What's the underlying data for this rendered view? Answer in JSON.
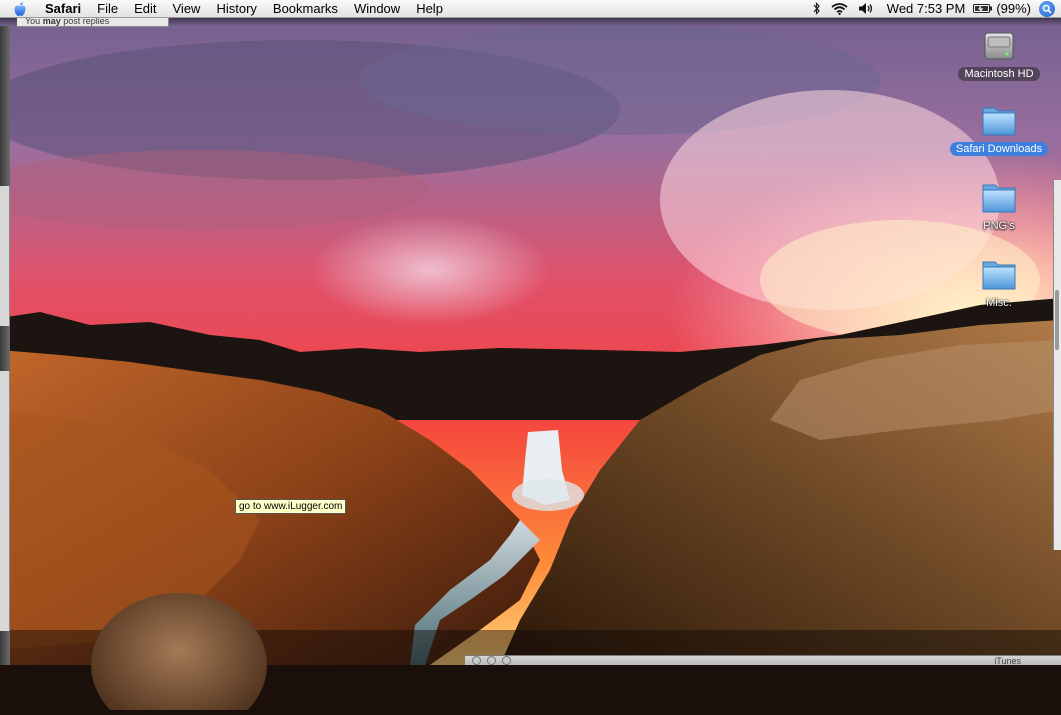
{
  "menubar": {
    "app_name": "Safari",
    "items": [
      "File",
      "Edit",
      "View",
      "History",
      "Bookmarks",
      "Window",
      "Help"
    ],
    "status": {
      "clock": "Wed 7:53 PM",
      "battery": "(99%)",
      "icons": [
        "bluetooth-icon",
        "wifi-icon",
        "volume-icon",
        "battery-icon",
        "spotlight-icon"
      ]
    }
  },
  "background_window": {
    "status_prefix": "You ",
    "status_bold": "may",
    "status_suffix": " post replies"
  },
  "desktop_icons": [
    {
      "label": "Macintosh HD",
      "icon": "hard-drive-icon"
    },
    {
      "label": "Safari Downloads",
      "icon": "folder-icon",
      "selected": true
    },
    {
      "label": "PNG's",
      "icon": "folder-icon"
    },
    {
      "label": "Misc.",
      "icon": "folder-icon"
    }
  ],
  "tooltip": {
    "text": "go to www.iLugger.com"
  },
  "bottom_window": {
    "title": "iTunes"
  },
  "colors": {
    "selection": "#3d80df",
    "menubar": "#ececec",
    "tooltip": "#ffffc8"
  }
}
